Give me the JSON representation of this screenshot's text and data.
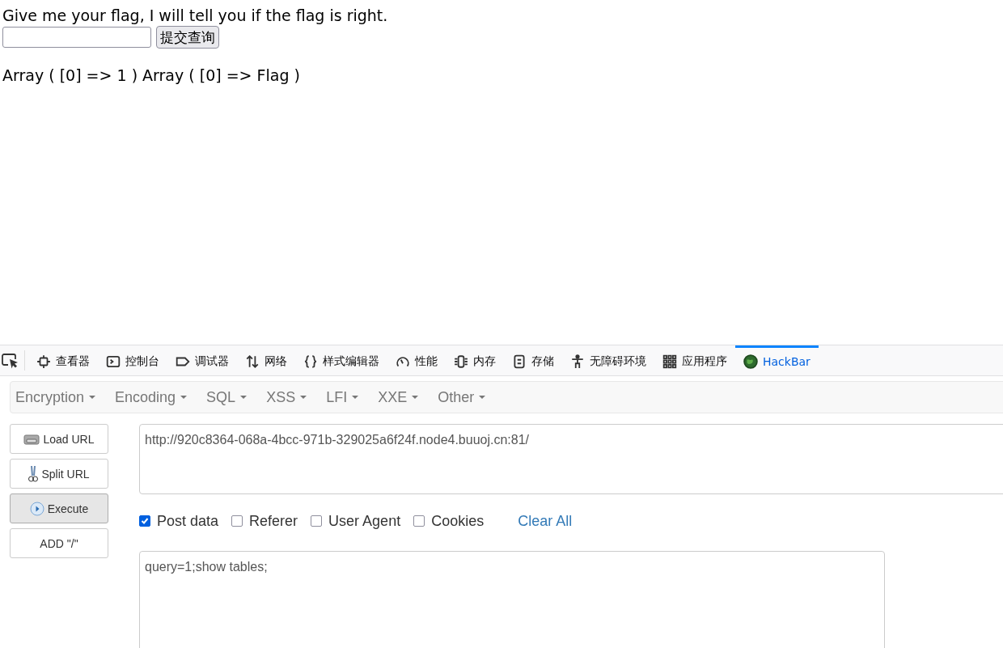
{
  "page": {
    "prompt": "Give me your flag, I will tell you if the flag is right.",
    "submit_button": "提交查询",
    "result": "Array ( [0] => 1 ) Array ( [0] => Flag )"
  },
  "devtools": {
    "tabs": [
      {
        "label": "查看器",
        "selected": false
      },
      {
        "label": "控制台",
        "selected": false
      },
      {
        "label": "调试器",
        "selected": false
      },
      {
        "label": "网络",
        "selected": false
      },
      {
        "label": "样式编辑器",
        "selected": false
      },
      {
        "label": "性能",
        "selected": false
      },
      {
        "label": "内存",
        "selected": false
      },
      {
        "label": "存储",
        "selected": false
      },
      {
        "label": "无障碍环境",
        "selected": false
      },
      {
        "label": "应用程序",
        "selected": false
      },
      {
        "label": "HackBar",
        "selected": true
      }
    ]
  },
  "hackbar": {
    "menus": [
      "Encryption",
      "Encoding",
      "SQL",
      "XSS",
      "LFI",
      "XXE",
      "Other"
    ],
    "buttons": [
      {
        "label": "Load URL",
        "selected": false
      },
      {
        "label": "Split URL",
        "selected": false
      },
      {
        "label": "Execute",
        "selected": true
      },
      {
        "label": "ADD \"/\"",
        "selected": false
      }
    ],
    "url": "http://920c8364-068a-4bcc-971b-329025a6f24f.node4.buuoj.cn:81/",
    "options": [
      {
        "label": "Post data",
        "checked": true
      },
      {
        "label": "Referer",
        "checked": false
      },
      {
        "label": "User Agent",
        "checked": false
      },
      {
        "label": "Cookies",
        "checked": false
      }
    ],
    "clear_all": "Clear All",
    "post_body": "query=1;show tables;"
  }
}
